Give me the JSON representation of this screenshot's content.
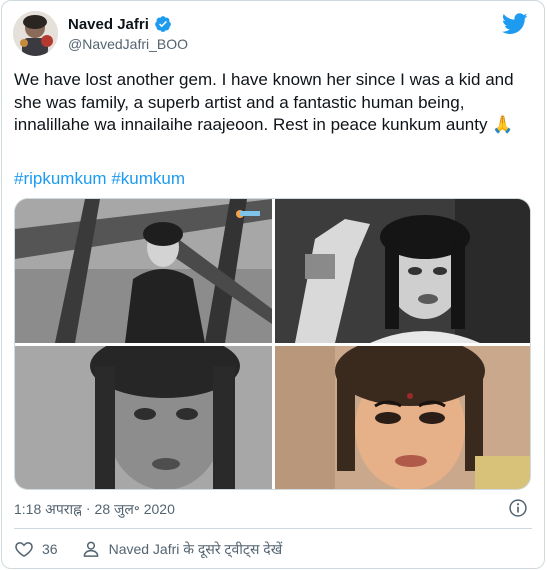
{
  "author": {
    "display_name": "Naved Jafri",
    "handle": "@NavedJafri_BOO",
    "verified": true
  },
  "tweet": {
    "text": "We have lost another gem. I have known her since I was a kid and she was family, a superb artist and a fantastic human being, innalillahe wa innailaihe raajeoon. Rest in peace kunkum aunty 🙏",
    "hashtags": [
      "#ripkumkum",
      "#kumkum"
    ]
  },
  "media": {
    "photos": [
      "photo-1",
      "photo-2",
      "photo-3",
      "photo-4"
    ]
  },
  "meta": {
    "time": "1:18 अपराह्न",
    "separator": "·",
    "date": "28 जुल॰ 2020"
  },
  "actions": {
    "like_count": "36",
    "more_label": "Naved Jafri के दूसरे ट्वीट्स देखें"
  },
  "icons": {
    "twitter": "twitter-bird-icon",
    "verified": "verified-badge-icon",
    "info": "info-icon",
    "like": "heart-icon",
    "profile": "person-icon"
  },
  "colors": {
    "brand": "#1d9bf0",
    "text": "#0f1419",
    "secondary": "#536471",
    "border": "#cfd9de"
  }
}
